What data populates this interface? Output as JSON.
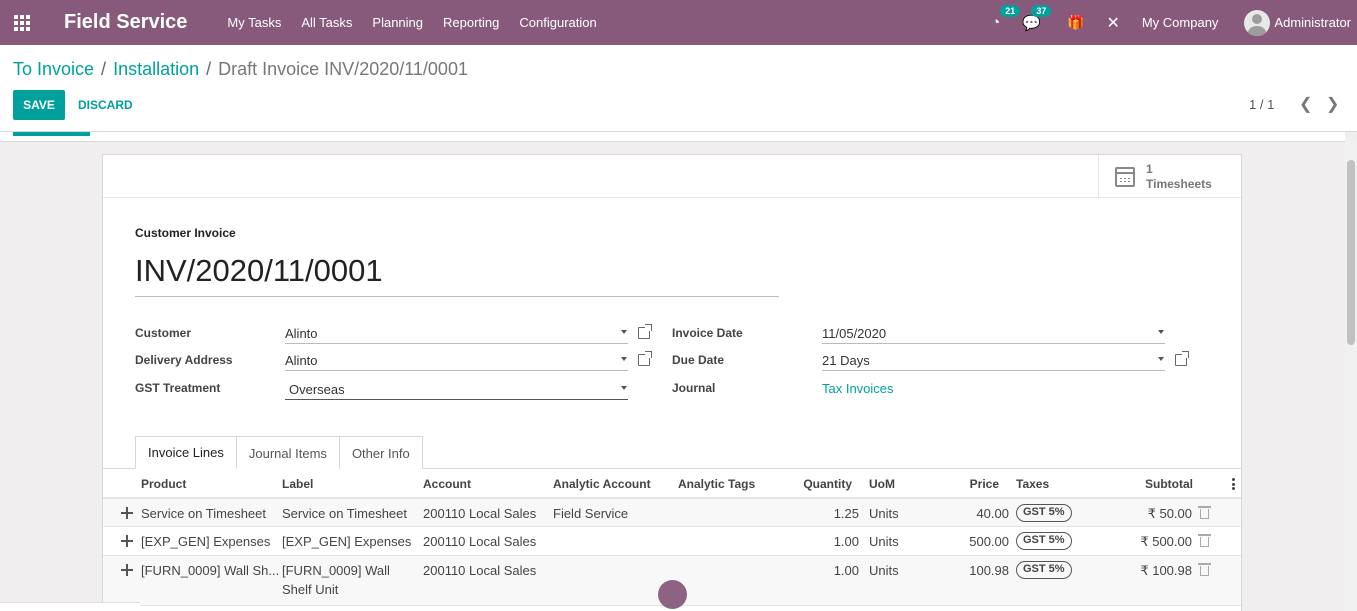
{
  "navbar": {
    "brand": "Field Service",
    "menu": [
      "My Tasks",
      "All Tasks",
      "Planning",
      "Reporting",
      "Configuration"
    ],
    "activities_count": "21",
    "messages_count": "37",
    "company": "My Company",
    "user": "Administrator"
  },
  "breadcrumb": {
    "items": [
      "To Invoice",
      "Installation"
    ],
    "current": "Draft Invoice INV/2020/11/0001"
  },
  "buttons": {
    "save": "SAVE",
    "discard": "DISCARD"
  },
  "pager": "1 / 1",
  "stat_button": {
    "value": "1",
    "label": "Timesheets"
  },
  "form": {
    "type_label": "Customer Invoice",
    "name": "INV/2020/11/0001",
    "customer_label": "Customer",
    "customer": "Alinto",
    "delivery_label": "Delivery Address",
    "delivery": "Alinto",
    "gst_label": "GST Treatment",
    "gst": "Overseas",
    "invoice_date_label": "Invoice Date",
    "invoice_date": "11/05/2020",
    "due_date_label": "Due Date",
    "due_date": "21 Days",
    "journal_label": "Journal",
    "journal": "Tax Invoices"
  },
  "tabs": [
    "Invoice Lines",
    "Journal Items",
    "Other Info"
  ],
  "table": {
    "columns": {
      "product": "Product",
      "label": "Label",
      "account": "Account",
      "analytic_account": "Analytic Account",
      "analytic_tags": "Analytic Tags",
      "quantity": "Quantity",
      "uom": "UoM",
      "price": "Price",
      "taxes": "Taxes",
      "subtotal": "Subtotal"
    },
    "rows": [
      {
        "product": "Service on Timesheet",
        "label": "Service on Timesheet",
        "account": "200110 Local Sales",
        "analytic_account": "Field Service",
        "quantity": "1.25",
        "uom": "Units",
        "price": "40.00",
        "tax": "GST 5%",
        "subtotal": "₹ 50.00"
      },
      {
        "product": "[EXP_GEN] Expenses",
        "label": "[EXP_GEN] Expenses",
        "account": "200110 Local Sales",
        "analytic_account": "",
        "quantity": "1.00",
        "uom": "Units",
        "price": "500.00",
        "tax": "GST 5%",
        "subtotal": "₹ 500.00"
      },
      {
        "product": "[FURN_0009] Wall Sh...",
        "label_line1": "[FURN_0009] Wall",
        "label_line2": "Shelf Unit",
        "account": "200110 Local Sales",
        "analytic_account": "",
        "quantity": "1.00",
        "uom": "Units",
        "price": "100.98",
        "tax": "GST 5%",
        "subtotal": "₹ 100.98"
      }
    ]
  },
  "colors": {
    "brand": "#875a7b",
    "accent": "#00a09d"
  }
}
